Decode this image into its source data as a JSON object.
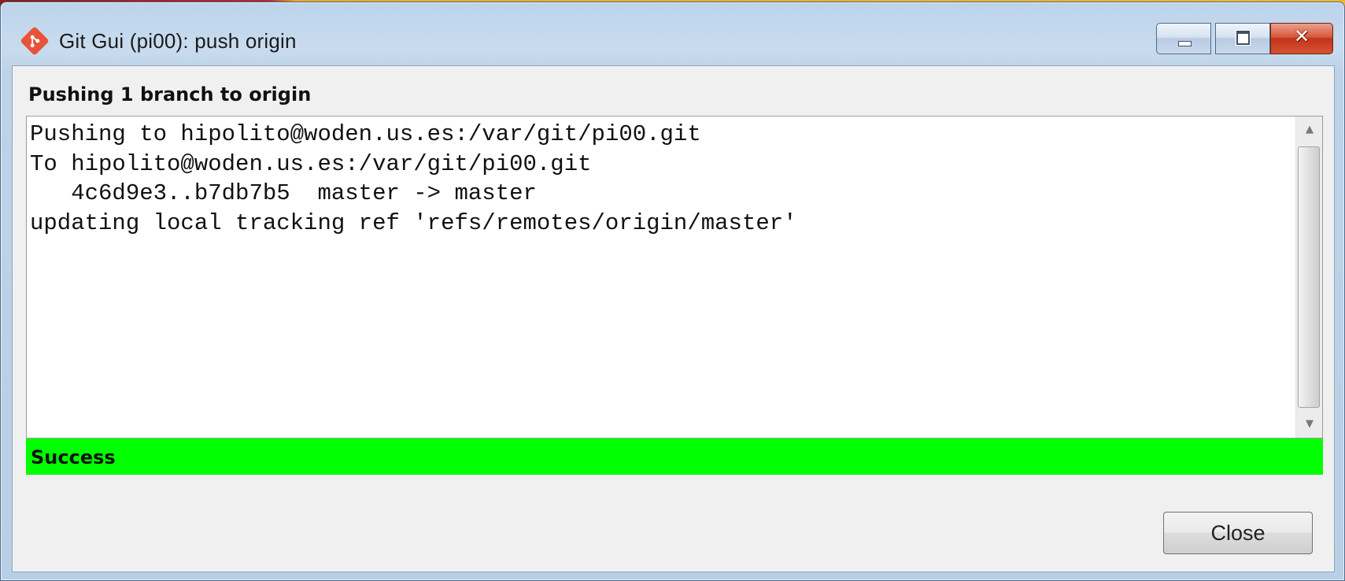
{
  "window": {
    "title": "Git Gui (pi00): push origin",
    "app_icon": "git-logo-icon",
    "controls": {
      "minimize_icon": "minimize-icon",
      "maximize_icon": "maximize-icon",
      "close_icon": "close-icon",
      "close_glyph": "✕"
    }
  },
  "dialog": {
    "heading": "Pushing 1 branch to origin",
    "log_lines": [
      "Pushing to hipolito@woden.us.es:/var/git/pi00.git",
      "To hipolito@woden.us.es:/var/git/pi00.git",
      "   4c6d9e3..b7db7b5  master -> master",
      "updating local tracking ref 'refs/remotes/origin/master'"
    ],
    "status": {
      "text": "Success",
      "color": "#00ff00"
    },
    "close_button_label": "Close"
  },
  "scrollbar": {
    "up_arrow_icon": "scroll-up-arrow-icon",
    "down_arrow_icon": "scroll-down-arrow-icon"
  }
}
